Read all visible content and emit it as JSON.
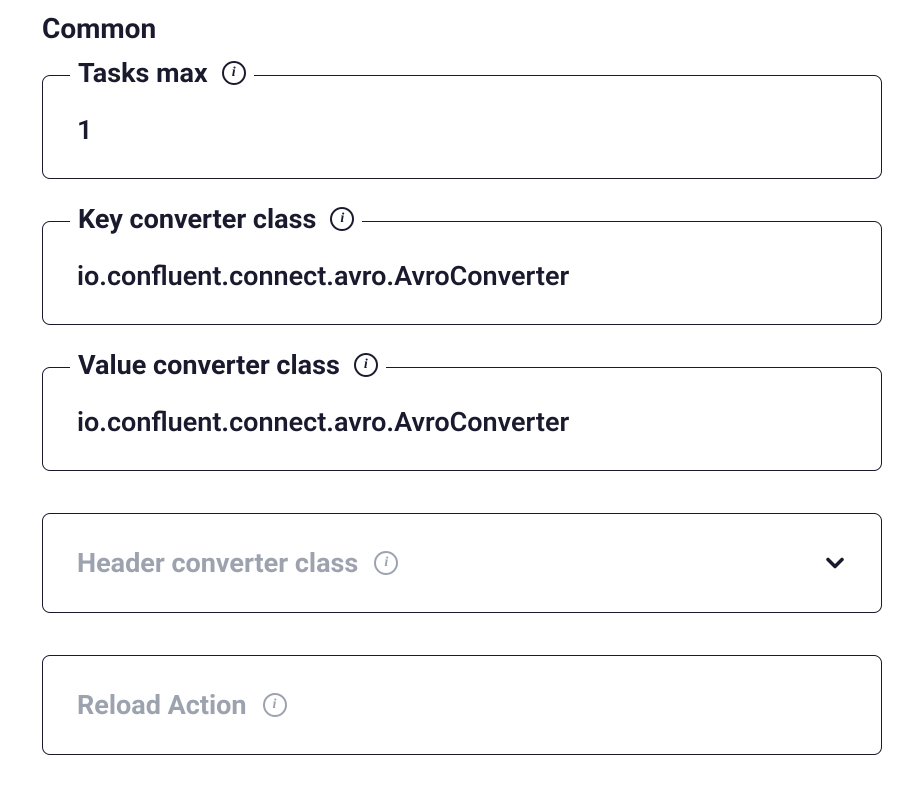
{
  "section": {
    "title": "Common"
  },
  "fields": {
    "tasks_max": {
      "label": "Tasks max",
      "value": "1"
    },
    "key_converter": {
      "label": "Key converter class",
      "value": "io.confluent.connect.avro.AvroConverter"
    },
    "value_converter": {
      "label": "Value converter class",
      "value": "io.confluent.connect.avro.AvroConverter"
    },
    "header_converter": {
      "label": "Header converter class",
      "value": ""
    },
    "reload_action": {
      "label": "Reload Action",
      "value": ""
    }
  }
}
